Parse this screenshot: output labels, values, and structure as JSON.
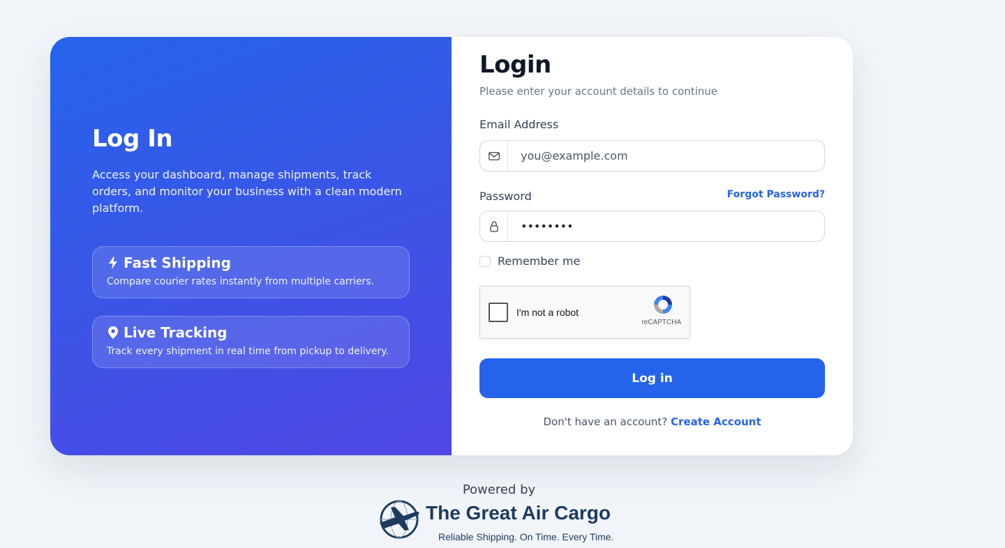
{
  "hero": {
    "title": "Log In",
    "description": "Access your dashboard, manage shipments, track orders, and monitor your business with a clean modern platform.",
    "features": [
      {
        "icon": "lightning-icon",
        "title": "Fast Shipping",
        "description": "Compare courier rates instantly from multiple carriers."
      },
      {
        "icon": "location-pin-icon",
        "title": "Live Tracking",
        "description": "Track every shipment in real time from pickup to delivery."
      }
    ]
  },
  "form": {
    "title": "Login",
    "subtitle": "Please enter your account details to continue",
    "email_label": "Email Address",
    "email_placeholder": "you@example.com",
    "email_icon": "envelope-icon",
    "password_label": "Password",
    "password_value": "••••••••",
    "password_icon": "lock-icon",
    "forgot_label": "Forgot Password?",
    "remember_label": "Remember me",
    "captcha_label": "I'm not a robot",
    "captcha_brand": "reCAPTCHA",
    "submit_label": "Log in",
    "signup_prompt": "Don't have an account?",
    "signup_link": "Create Account"
  },
  "footer": {
    "powered_by": "Powered by",
    "brand_name": "The Great Air Cargo",
    "brand_tagline": "Reliable Shipping. On Time. Every Time."
  },
  "colors": {
    "accent": "#2563eb",
    "hero_start": "#2563eb",
    "hero_end": "#4f46e5",
    "brand_navy": "#1e3a5f"
  }
}
